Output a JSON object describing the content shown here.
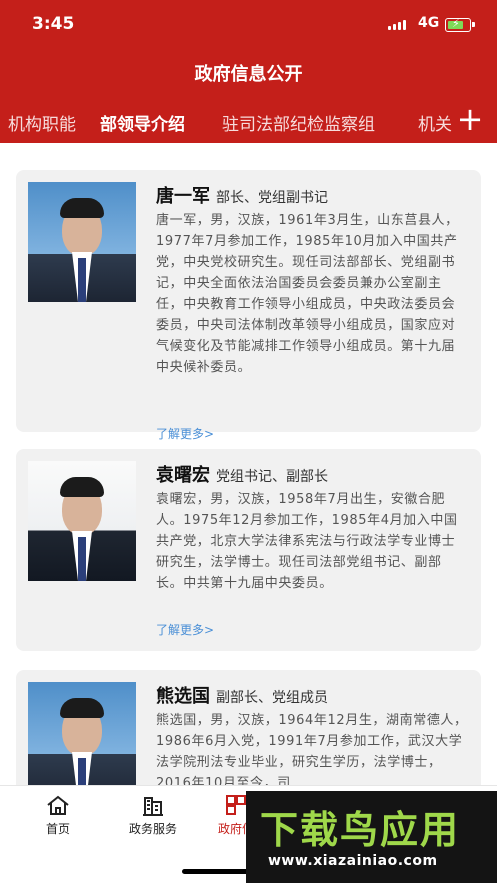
{
  "status": {
    "time": "3:45",
    "network": "4G"
  },
  "header": {
    "title": "政府信息公开"
  },
  "tabs": [
    {
      "label": "机构职能"
    },
    {
      "label": "部领导介绍"
    },
    {
      "label": "驻司法部纪检监察组"
    },
    {
      "label": "机关"
    }
  ],
  "leaders": [
    {
      "name": "唐一军",
      "role": "部长、党组副书记",
      "bio": "唐一军，男，汉族，1961年3月生，山东莒县人，1977年7月参加工作，1985年10月加入中国共产党，中央党校研究生。现任司法部部长、党组副书记，中央全面依法治国委员会委员兼办公室副主任，中央教育工作领导小组成员，中央政法委员会委员，中央司法体制改革领导小组成员，国家应对气候变化及节能减排工作领导小组成员。第十九届中央候补委员。",
      "more": "了解更多>"
    },
    {
      "name": "袁曙宏",
      "role": "党组书记、副部长",
      "bio": "袁曙宏，男，汉族，1958年7月出生，安徽合肥人。1975年12月参加工作，1985年4月加入中国共产党，北京大学法律系宪法与行政法学专业博士研究生，法学博士。现任司法部党组书记、副部长。中共第十九届中央委员。",
      "more": "了解更多>"
    },
    {
      "name": "熊选国",
      "role": "副部长、党组成员",
      "bio": "熊选国，男，汉族，1964年12月生，湖南常德人，1986年6月入党，1991年7月参加工作，武汉大学法学院刑法专业毕业，研究生学历，法学博士，2016年10月至今，司"
    }
  ],
  "tabbar": [
    {
      "label": "首页",
      "icon": "home-icon"
    },
    {
      "label": "政务服务",
      "icon": "building-icon"
    },
    {
      "label": "政府信",
      "icon": "grid-icon"
    }
  ],
  "watermark": {
    "text": "下载鸟应用",
    "url": "www.xiazainiao.com"
  },
  "colors": {
    "brand": "#c41f1a",
    "link": "#4a8fd6",
    "card": "#f1f1f1"
  }
}
